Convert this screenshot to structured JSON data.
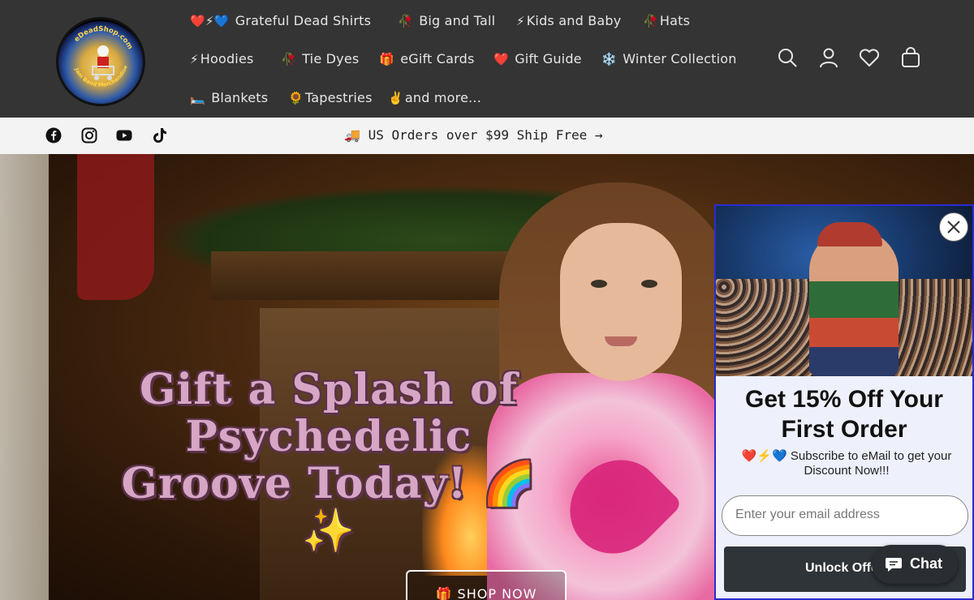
{
  "header": {
    "logo_text": "eDeadShop.com Jam Band Merchandise And Tie Dyes",
    "nav": [
      {
        "emoji": "❤️⚡💙",
        "label": "Grateful Dead Shirts"
      },
      {
        "emoji": "🥀",
        "label": "Big and Tall"
      },
      {
        "emoji": "⚡",
        "label": "Kids and Baby"
      },
      {
        "emoji": "🥀",
        "label": "Hats"
      },
      {
        "emoji": "⚡",
        "label": "Hoodies"
      },
      {
        "emoji": "🥀",
        "label": "Tie Dyes"
      },
      {
        "emoji": "🎁",
        "label": "eGift Cards"
      },
      {
        "emoji": "❤️",
        "label": "Gift Guide"
      },
      {
        "emoji": "❄️",
        "label": "Winter Collection"
      },
      {
        "emoji": "🛏️",
        "label": "Blankets"
      },
      {
        "emoji": "🌻",
        "label": "Tapestries"
      },
      {
        "emoji": "✌️",
        "label": "and more..."
      }
    ],
    "icons": [
      "search-icon",
      "account-icon",
      "wishlist-icon",
      "cart-icon"
    ]
  },
  "announcement": {
    "socials": [
      "facebook-icon",
      "instagram-icon",
      "youtube-icon",
      "tiktok-icon"
    ],
    "emoji": "🚚",
    "text": "US Orders over $99 Ship Free",
    "arrow": "→"
  },
  "hero": {
    "headline": "Gift a Splash of Psychedelic Groove Today! 🌈✨",
    "button_emoji": "🎁",
    "button_label": "SHOP NOW"
  },
  "popup": {
    "title": "Get 15% Off Your First Order",
    "subtitle_emoji": "❤️⚡💙",
    "subtitle": "Subscribe to eMail to get your Discount Now!!!",
    "email_placeholder": "Enter your email address",
    "submit_label": "Unlock Offer"
  },
  "chat": {
    "label": "Chat"
  },
  "colors": {
    "header_bg": "#343434",
    "bar_bg": "#f3f3f3",
    "popup_border": "#2b2bd1",
    "popup_bg": "#eef0fb",
    "button_dark": "#2f3438"
  }
}
